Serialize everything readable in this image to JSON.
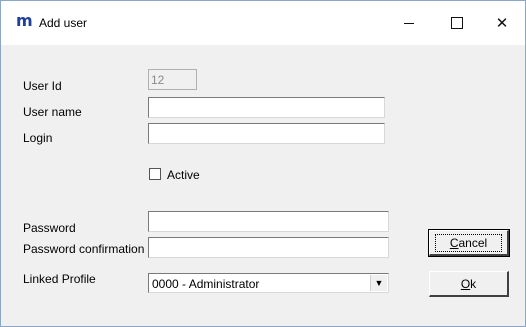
{
  "window": {
    "logo": "m",
    "title": "Add  user",
    "min_icon": "minimize-icon",
    "max_icon": "maximize-icon",
    "close_glyph": "✕"
  },
  "form": {
    "user_id_label": "User Id",
    "user_id_value": "12",
    "user_name_label": "User name",
    "user_name_value": "",
    "login_label": "Login",
    "login_value": "",
    "active_label": "Active",
    "active_checked": false,
    "password_label": "Password",
    "password_value": "",
    "password_confirm_label": "Password confirmation",
    "password_confirm_value": "",
    "linked_profile_label": "Linked Profile",
    "linked_profile_value": "0000 - Administrator"
  },
  "buttons": {
    "cancel_first": "C",
    "cancel_rest": "ancel",
    "ok_first": "O",
    "ok_rest": "k"
  }
}
